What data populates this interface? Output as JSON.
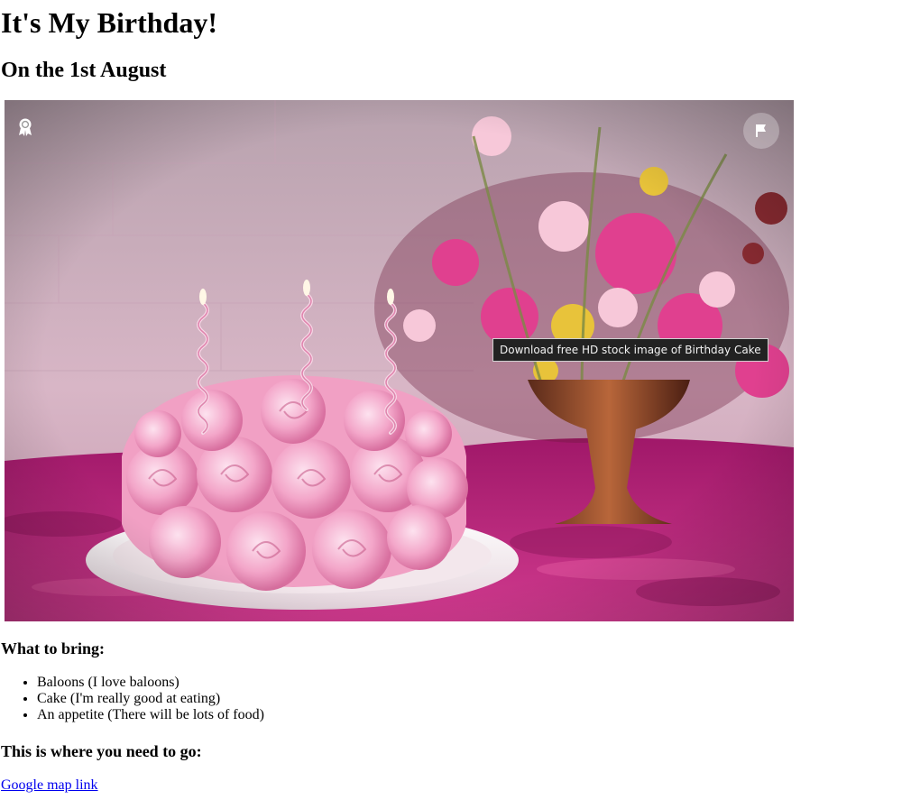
{
  "page": {
    "title": "It's My Birthday!",
    "subtitle": "On the 1st August"
  },
  "photo": {
    "tooltip": "Download free HD stock image of Birthday Cake",
    "alt": "Birthday Cake",
    "top_left_icon": "award-ribbon-icon",
    "top_right_icon": "flag-icon"
  },
  "bring": {
    "heading": "What to bring:",
    "items": [
      "Baloons (I love baloons)",
      "Cake (I'm really good at eating)",
      "An appetite (There will be lots of food)"
    ]
  },
  "directions": {
    "heading": "This is where you need to go:",
    "link_text": "Google map link"
  }
}
